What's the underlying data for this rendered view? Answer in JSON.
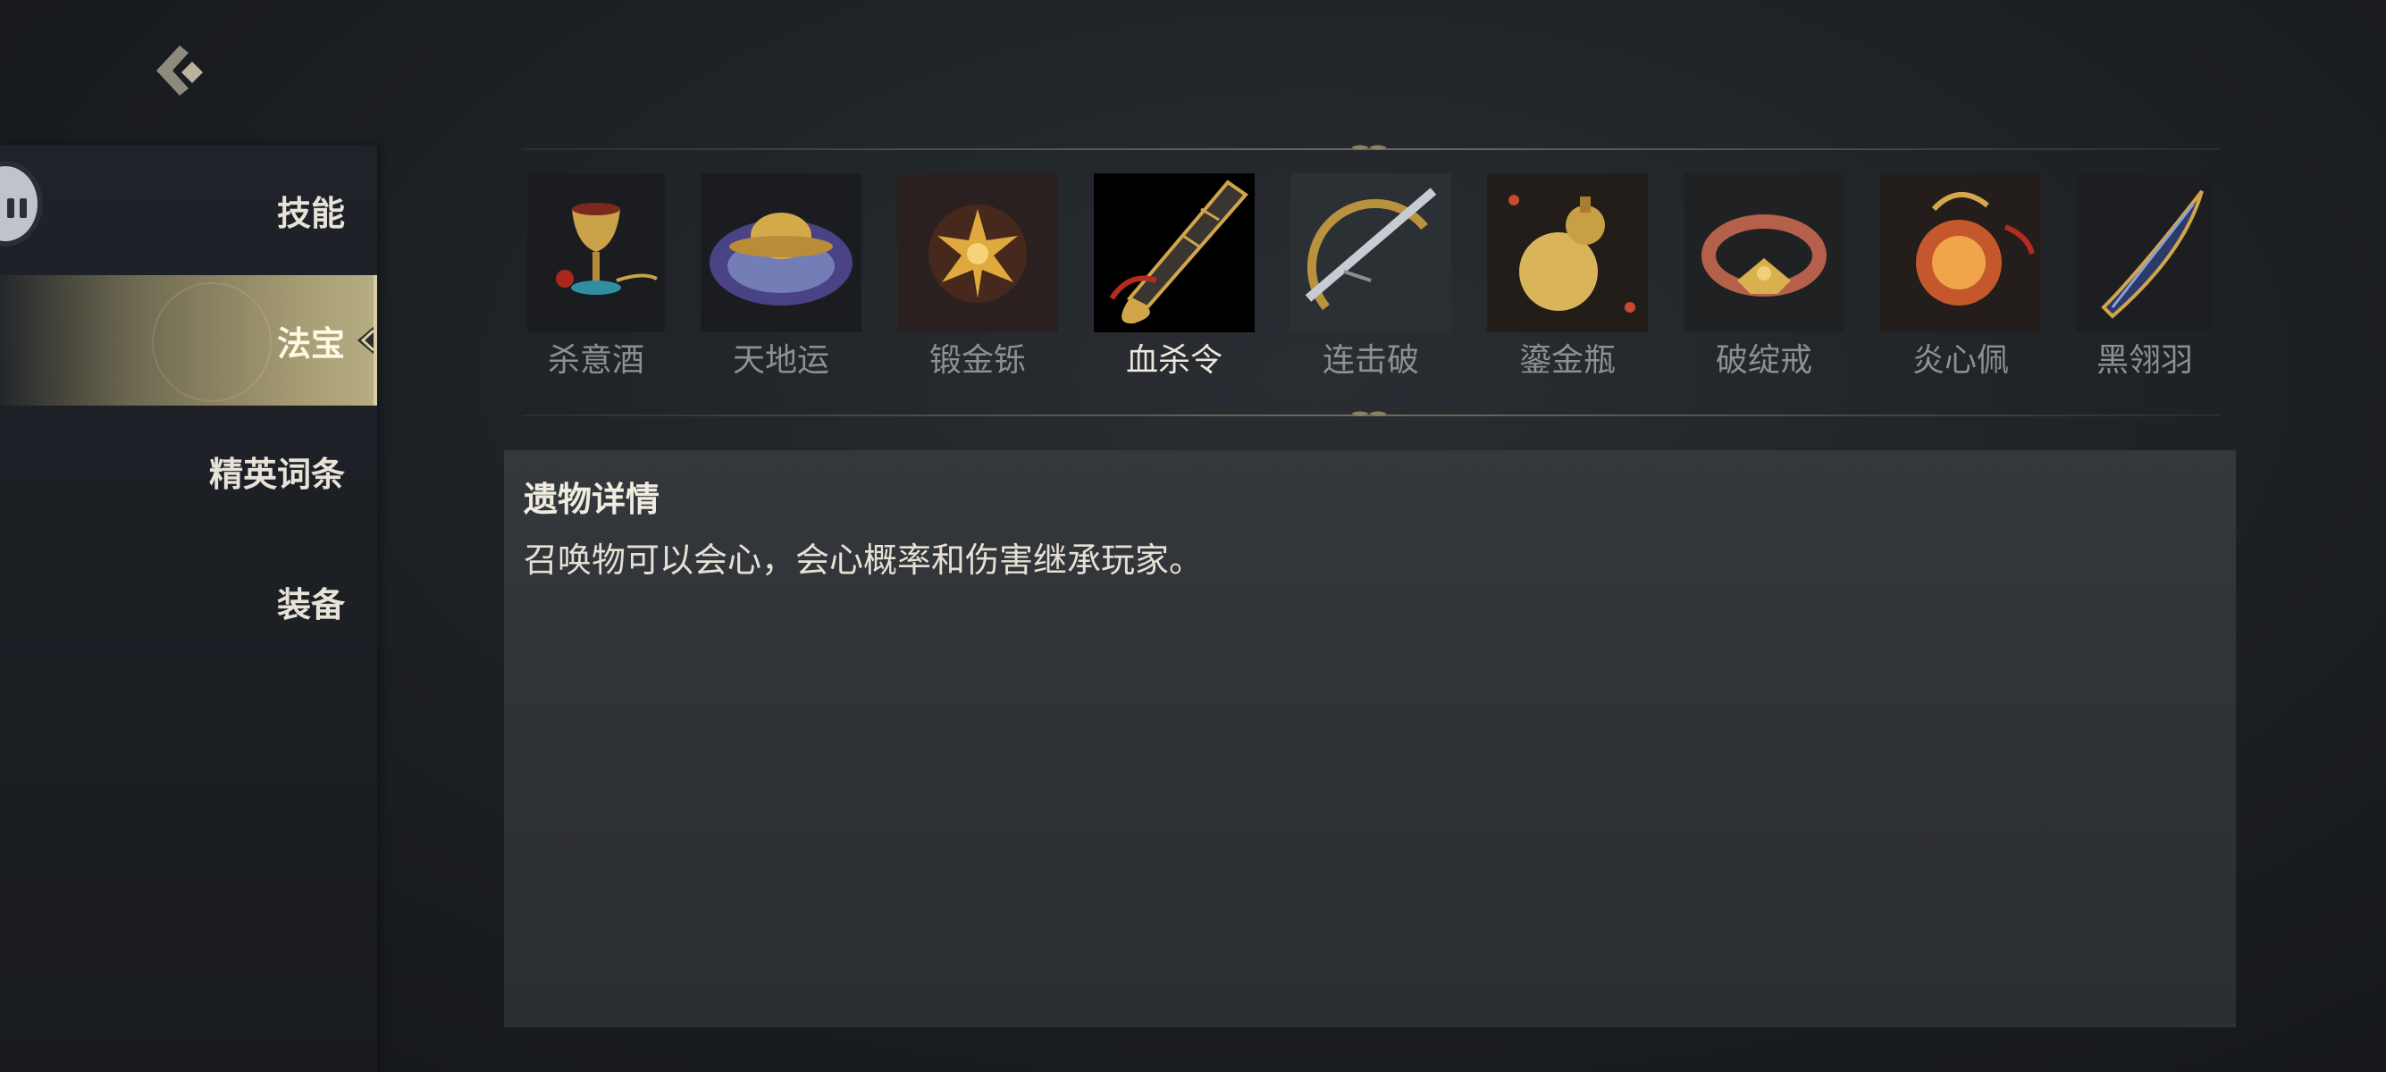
{
  "sidebar": {
    "items": [
      {
        "label": "技能"
      },
      {
        "label": "法宝"
      },
      {
        "label": "精英词条"
      },
      {
        "label": "装备"
      }
    ]
  },
  "relics": [
    {
      "name": "杀意酒",
      "icon": "wine-goblet-icon"
    },
    {
      "name": "天地运",
      "icon": "swirling-orb-icon"
    },
    {
      "name": "锻金铄",
      "icon": "golden-spiked-emblem-icon"
    },
    {
      "name": "血杀令",
      "icon": "blood-blade-token-icon"
    },
    {
      "name": "连击破",
      "icon": "crescent-blade-icon"
    },
    {
      "name": "鎏金瓶",
      "icon": "golden-gourd-icon"
    },
    {
      "name": "破绽戒",
      "icon": "ornate-ring-icon"
    },
    {
      "name": "炎心佩",
      "icon": "flame-pendant-icon"
    },
    {
      "name": "黑翎羽",
      "icon": "dark-feather-icon"
    }
  ],
  "selected_relic": "血杀令",
  "detail": {
    "title": "遗物详情",
    "description": "召唤物可以会心，会心概率和伤害继承玩家。"
  },
  "colors": {
    "accent_gold": "#b7ad84",
    "panel": "#303337",
    "background": "#1c1f23"
  }
}
